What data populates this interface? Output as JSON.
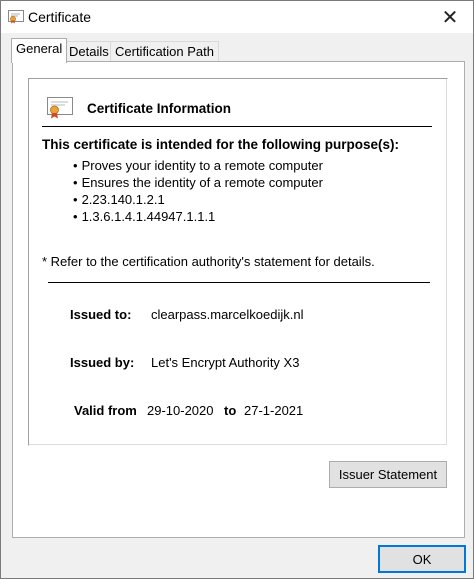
{
  "window": {
    "title": "Certificate",
    "close_glyph": "✕"
  },
  "tabs": [
    {
      "label": "General",
      "active": true
    },
    {
      "label": "Details",
      "active": false
    },
    {
      "label": "Certification Path",
      "active": false
    }
  ],
  "general": {
    "heading": "Certificate Information",
    "purpose_title": "This certificate is intended for the following purpose(s):",
    "purposes": [
      "Proves your identity to a remote computer",
      "Ensures the identity of a remote computer",
      "2.23.140.1.2.1",
      "1.3.6.1.4.1.44947.1.1.1"
    ],
    "refer_note": "* Refer to the certification authority's statement for details.",
    "issued_to_label": "Issued to:",
    "issued_to_value": "clearpass.marcelkoedijk.nl",
    "issued_by_label": "Issued by:",
    "issued_by_value": "Let's Encrypt Authority X3",
    "valid_from_label": "Valid from",
    "valid_from_value": "29-10-2020",
    "valid_to_label": "to",
    "valid_to_value": "27-1-2021"
  },
  "buttons": {
    "issuer_statement": "Issuer Statement",
    "ok": "OK"
  },
  "icons": {
    "title_icon": "certificate-icon",
    "info_icon": "certificate-icon",
    "close": "close-icon"
  },
  "colors": {
    "accent": "#0078d7",
    "ribbon": "#e8a33a"
  }
}
